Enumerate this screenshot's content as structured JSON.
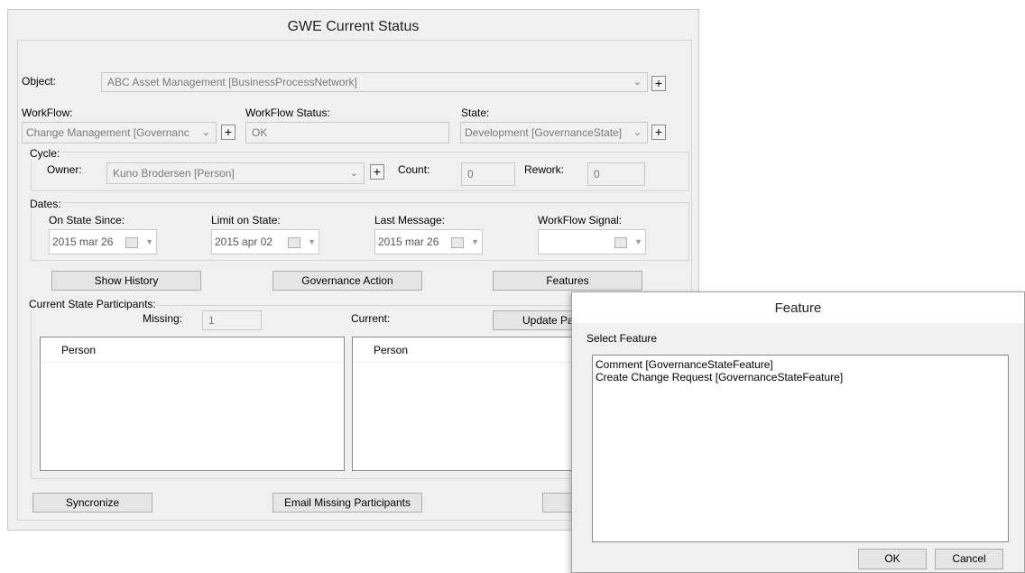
{
  "main": {
    "title": "GWE Current Status",
    "object": {
      "label": "Object:",
      "value": "ABC Asset Management [BusinessProcessNetwork]"
    },
    "workflow": {
      "label": "WorkFlow:",
      "value": "Change Management [Governanc"
    },
    "workflow_status": {
      "label": "WorkFlow Status:",
      "value": "OK"
    },
    "state": {
      "label": "State:",
      "value": "Development [GovernanceState]"
    },
    "cycle": {
      "group_label": "Cycle:",
      "owner_label": "Owner:",
      "owner_value": "Kuno Brodersen [Person]",
      "count_label": "Count:",
      "count_value": "0",
      "rework_label": "Rework:",
      "rework_value": "0"
    },
    "dates": {
      "group_label": "Dates:",
      "on_state_since_label": "On State Since:",
      "on_state_since_value": "2015 mar 26",
      "limit_on_state_label": "Limit on State:",
      "limit_on_state_value": "2015 apr 02",
      "last_message_label": "Last Message:",
      "last_message_value": "2015 mar 26",
      "workflow_signal_label": "WorkFlow Signal:",
      "workflow_signal_value": ""
    },
    "buttons": {
      "show_history": "Show History",
      "governance_action": "Governance Action",
      "features": "Features",
      "update_participants": "Update Pa",
      "syncronize": "Syncronize",
      "email_missing": "Email Missing Participants"
    },
    "participants": {
      "group_label": "Current State Participants:",
      "missing_label": "Missing:",
      "missing_value": "1",
      "current_label": "Current:",
      "missing_list_header": "Person",
      "current_list_header": "Person"
    }
  },
  "feature_dialog": {
    "title": "Feature",
    "select_label": "Select Feature",
    "items": [
      "Comment [GovernanceStateFeature]",
      "Create Change Request [GovernanceStateFeature]"
    ],
    "ok": "OK",
    "cancel": "Cancel"
  }
}
